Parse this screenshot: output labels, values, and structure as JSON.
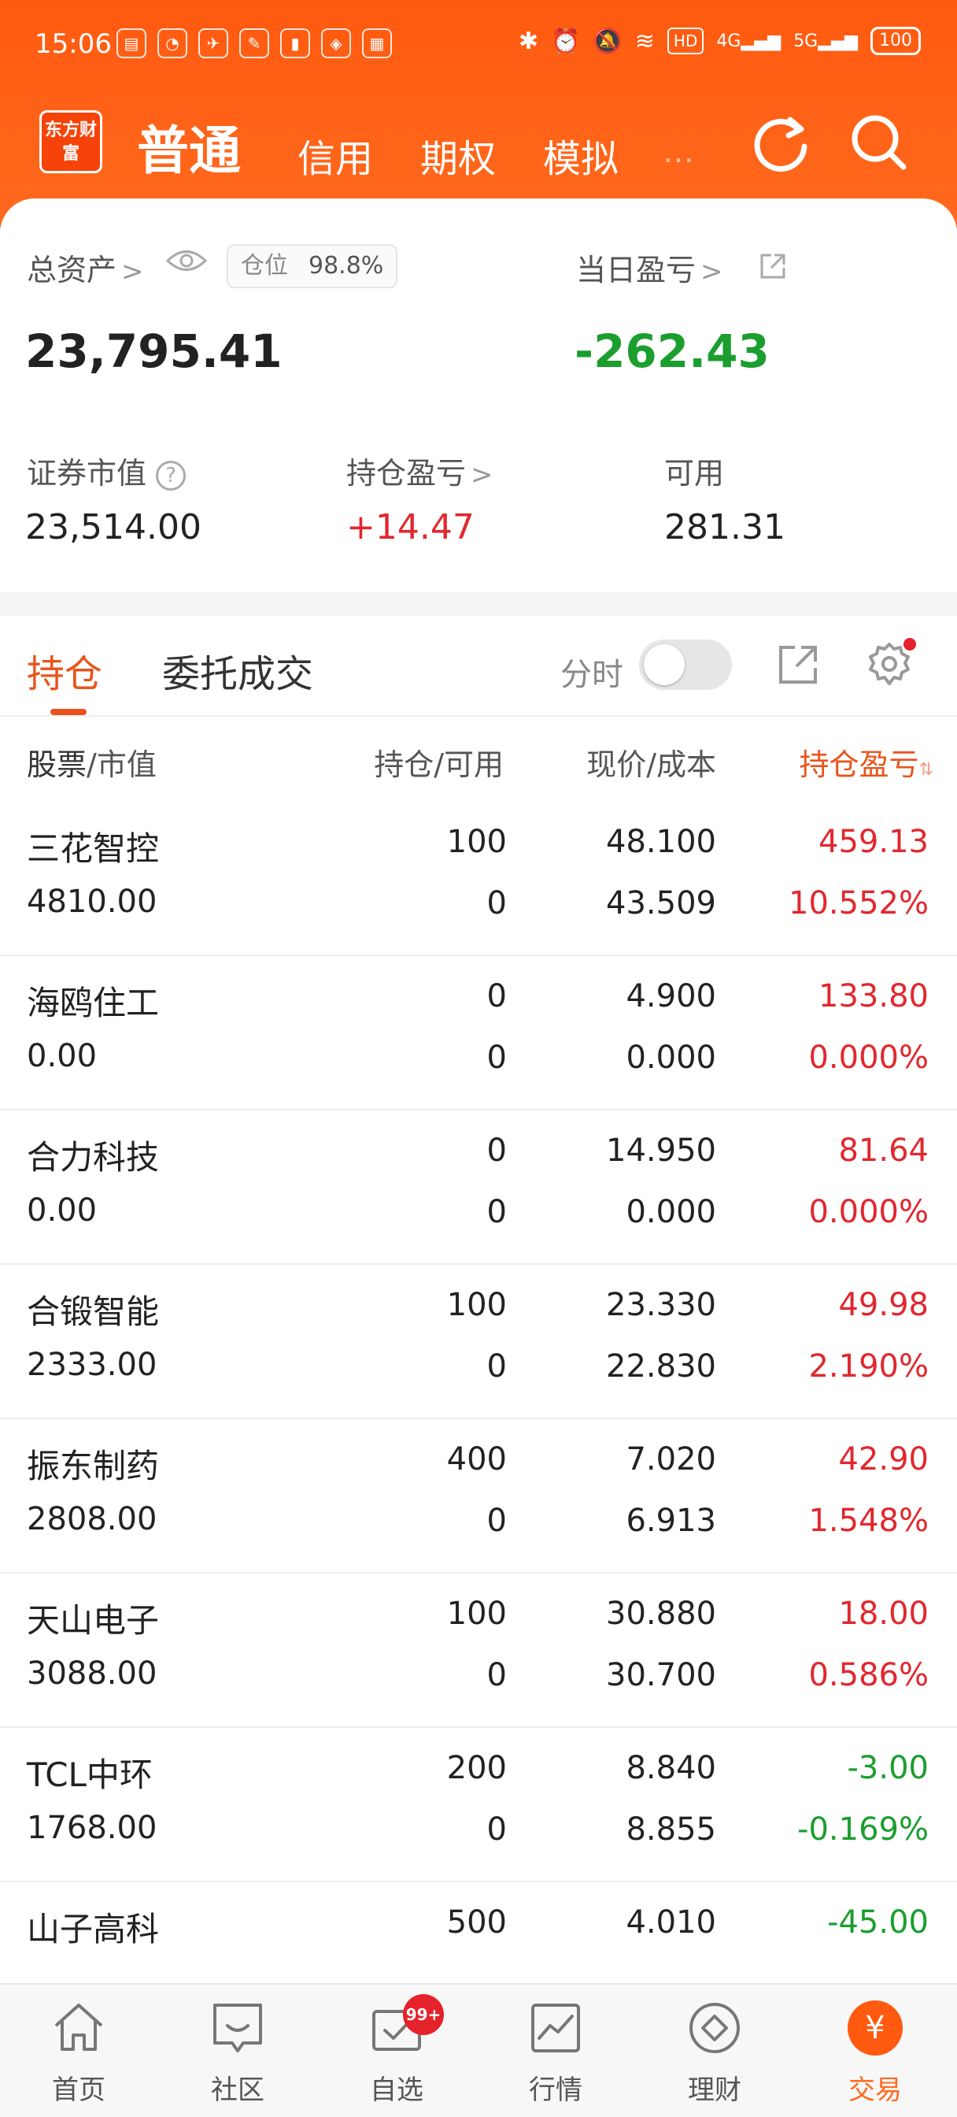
{
  "status_bar": {
    "time": "15:06",
    "network_4g": "4G",
    "network_5g": "5G",
    "hd1": "HD",
    "battery": "100"
  },
  "header": {
    "logo_text": "东方财富",
    "tabs": [
      {
        "label": "普通",
        "active": true
      },
      {
        "label": "信用"
      },
      {
        "label": "期权"
      },
      {
        "label": "模拟"
      }
    ],
    "tab_fade": "…"
  },
  "summary": {
    "total_assets_label": "总资产",
    "total_assets_value": "23,795.41",
    "position_label": "仓位",
    "position_value": "98.8%",
    "daily_pl_label": "当日盈亏",
    "daily_pl_value": "-262.43",
    "market_value_label": "证券市值",
    "market_value": "23,514.00",
    "holding_pl_label": "持仓盈亏",
    "holding_pl_value": "+14.47",
    "available_label": "可用",
    "available_value": "281.31"
  },
  "tabs": {
    "holdings": "持仓",
    "orders": "委托成交",
    "fenshi": "分时"
  },
  "table": {
    "headers": {
      "stock_a": "股票",
      "stock_b": "/市值",
      "position": "持仓/可用",
      "price": "现价/成本",
      "pl": "持仓盈亏"
    },
    "rows": [
      {
        "name": "三花智控",
        "market_value": "4810.00",
        "position": "100",
        "available": "0",
        "price": "48.100",
        "cost": "43.509",
        "pl": "459.13",
        "pl_pct": "10.552%",
        "dir": "up"
      },
      {
        "name": "海鸥住工",
        "market_value": "0.00",
        "position": "0",
        "available": "0",
        "price": "4.900",
        "cost": "0.000",
        "pl": "133.80",
        "pl_pct": "0.000%",
        "dir": "up"
      },
      {
        "name": "合力科技",
        "market_value": "0.00",
        "position": "0",
        "available": "0",
        "price": "14.950",
        "cost": "0.000",
        "pl": "81.64",
        "pl_pct": "0.000%",
        "dir": "up"
      },
      {
        "name": "合锻智能",
        "market_value": "2333.00",
        "position": "100",
        "available": "0",
        "price": "23.330",
        "cost": "22.830",
        "pl": "49.98",
        "pl_pct": "2.190%",
        "dir": "up"
      },
      {
        "name": "振东制药",
        "market_value": "2808.00",
        "position": "400",
        "available": "0",
        "price": "7.020",
        "cost": "6.913",
        "pl": "42.90",
        "pl_pct": "1.548%",
        "dir": "up"
      },
      {
        "name": "天山电子",
        "market_value": "3088.00",
        "position": "100",
        "available": "0",
        "price": "30.880",
        "cost": "30.700",
        "pl": "18.00",
        "pl_pct": "0.586%",
        "dir": "up"
      },
      {
        "name": "TCL中环",
        "market_value": "1768.00",
        "position": "200",
        "available": "0",
        "price": "8.840",
        "cost": "8.855",
        "pl": "-3.00",
        "pl_pct": "-0.169%",
        "dir": "down"
      },
      {
        "name": "山子高科",
        "market_value": "",
        "position": "500",
        "available": "",
        "price": "4.010",
        "cost": "",
        "pl": "-45.00",
        "pl_pct": "",
        "dir": "down"
      }
    ]
  },
  "bottom_nav": [
    {
      "label": "首页",
      "icon": "home-icon"
    },
    {
      "label": "社区",
      "icon": "community-icon"
    },
    {
      "label": "自选",
      "icon": "watchlist-icon",
      "badge": "99+"
    },
    {
      "label": "行情",
      "icon": "market-icon"
    },
    {
      "label": "理财",
      "icon": "finance-icon"
    },
    {
      "label": "交易",
      "icon": "trade-icon",
      "active": true
    }
  ],
  "colors": {
    "brand": "#ff5a10",
    "accent": "#e8541c",
    "up": "#e0282e",
    "down": "#1b9e2e"
  }
}
